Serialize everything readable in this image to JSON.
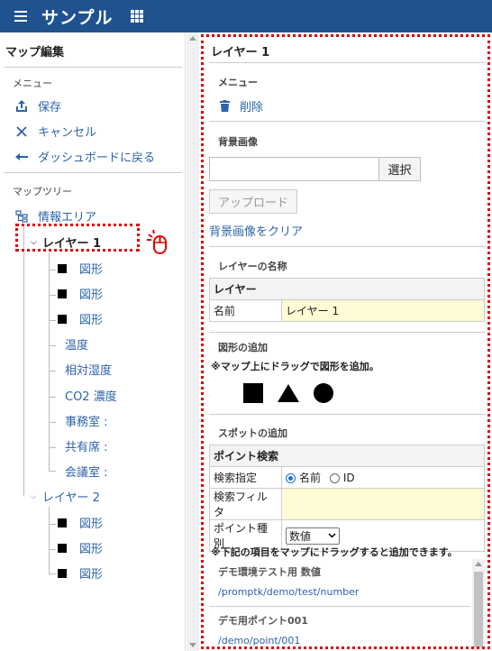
{
  "header": {
    "title": "サンプル"
  },
  "sidebar": {
    "title": "マップ編集",
    "menu_label": "メニュー",
    "menu": [
      {
        "label": "保存",
        "icon": "upload-icon"
      },
      {
        "label": "キャンセル",
        "icon": "close-icon"
      },
      {
        "label": "ダッシュボードに戻る",
        "icon": "arrow-left-icon"
      }
    ],
    "tree_label": "マップツリー",
    "tree_root": "情報エリア",
    "layer1": {
      "label": "レイヤー 1",
      "children": [
        "図形",
        "図形",
        "図形",
        "温度",
        "相対湿度",
        "CO2 濃度",
        "事務室 :",
        "共有席 :",
        "会議室 :"
      ]
    },
    "layer2": {
      "label": "レイヤー 2",
      "children": [
        "図形",
        "図形",
        "図形"
      ]
    }
  },
  "panel": {
    "title": "レイヤー 1",
    "menu_label": "メニュー",
    "delete_label": "削除",
    "bg_label": "背景画像",
    "file_value": "",
    "select_label": "選択",
    "upload_label": "アップロード",
    "clear_bg_label": "背景画像をクリア",
    "layer_name_label": "レイヤーの名称",
    "layer_table_header": "レイヤー",
    "name_label": "名前",
    "name_value": "レイヤー 1",
    "shape_add_label": "図形の追加",
    "shape_hint": "※マップ上にドラッグで図形を追加。",
    "spot_add_label": "スポットの追加",
    "point_search_header": "ポイント検索",
    "search_by_label": "検索指定",
    "search_by_options": [
      "名前",
      "ID"
    ],
    "search_filter_label": "検索フィルタ",
    "search_filter_value": "",
    "point_type_label": "ポイント種別",
    "point_type_value": "数値",
    "drag_hint": "※下記の項目をマップにドラッグすると追加できます。",
    "points": [
      {
        "title": "デモ環境テスト用 数値",
        "path": "/promptk/demo/test/number"
      },
      {
        "title": "デモ用ポイント001",
        "path": "/demo/point/001"
      }
    ]
  },
  "colors": {
    "header_bg": "#20528f",
    "link": "#2e64a8",
    "highlight": "#e00000",
    "input_yellow": "#fffbd4"
  }
}
